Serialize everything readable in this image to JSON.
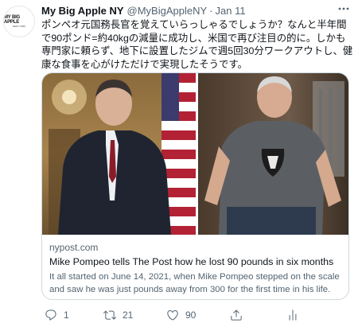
{
  "author": {
    "name": "My Big Apple NY",
    "handle": "@MyBigAppleNY",
    "separator": "·",
    "date": "Jan 11",
    "avatar_logo": "MY BIG APPLE",
    "avatar_sub": "NEW YORK"
  },
  "tweet": {
    "text": "ポンペオ元国務長官を覚えていらっしゃるでしょうか？なんと半年間で90ポンド=約40kgの減量に成功し、米国で再び注目の的に。しかも専門家に頼らず、地下に設置したジムで週5回30分ワークアウトし、健康な食事を心がけただけで実現したそうです。"
  },
  "card": {
    "domain": "nypost.com",
    "title": "Mike Pompeo tells The Post how he lost 90 pounds in six months",
    "description": "It all started on June 14, 2021, when Mike Pompeo stepped on the scale and saw he was just pounds away from 300 for the first time in his life."
  },
  "actions": {
    "reply_count": "1",
    "retweet_count": "21",
    "like_count": "90"
  },
  "icons": {
    "more": "more-dots-icon",
    "reply": "reply-icon",
    "retweet": "retweet-icon",
    "like": "heart-icon",
    "share": "share-icon"
  },
  "colors": {
    "text": "#0f1419",
    "secondary": "#536471",
    "border": "#cfd9de"
  }
}
